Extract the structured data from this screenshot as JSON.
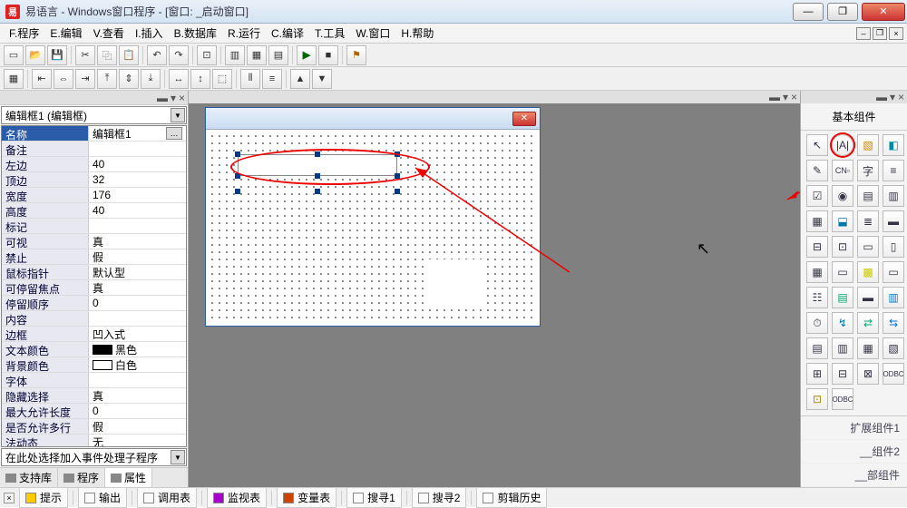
{
  "title": "易语言 - Windows窗口程序 - [窗口: _启动窗口]",
  "menu": [
    "F.程序",
    "E.编辑",
    "V.查看",
    "I.插入",
    "B.数据库",
    "R.运行",
    "C.编译",
    "T.工具",
    "W.窗口",
    "H.帮助"
  ],
  "left": {
    "combo_top": "编辑框1 (编辑框)",
    "combo_event": "在此处选择加入事件处理子程序",
    "tabs": [
      "支持库",
      "程序",
      "属性"
    ],
    "rows": [
      {
        "n": "名称",
        "v": "编辑框1",
        "sel": true,
        "btn": true
      },
      {
        "n": "备注",
        "v": ""
      },
      {
        "n": "左边",
        "v": "40"
      },
      {
        "n": "顶边",
        "v": "32"
      },
      {
        "n": "宽度",
        "v": "176"
      },
      {
        "n": "高度",
        "v": "40"
      },
      {
        "n": "标记",
        "v": ""
      },
      {
        "n": "可视",
        "v": "真"
      },
      {
        "n": "禁止",
        "v": "假"
      },
      {
        "n": "鼠标指针",
        "v": "默认型"
      },
      {
        "n": "可停留焦点",
        "v": "真"
      },
      {
        "n": "停留顺序",
        "v": "0"
      },
      {
        "n": "内容",
        "v": ""
      },
      {
        "n": "边框",
        "v": "凹入式"
      },
      {
        "n": "文本颜色",
        "v": "黑色",
        "sw": "#000000"
      },
      {
        "n": "背景颜色",
        "v": "白色",
        "sw": "#ffffff"
      },
      {
        "n": "字体",
        "v": ""
      },
      {
        "n": "隐藏选择",
        "v": "真"
      },
      {
        "n": "最大允许长度",
        "v": "0"
      },
      {
        "n": "是否允许多行",
        "v": "假"
      },
      {
        "n": "法动态",
        "v": "无"
      }
    ]
  },
  "right": {
    "title": "基本组件",
    "groups": [
      "扩展组件1",
      "__组件2",
      "__部组件"
    ]
  },
  "status": [
    "提示",
    "输出",
    "调用表",
    "监视表",
    "变量表",
    "搜寻1",
    "搜寻2",
    "剪辑历史"
  ],
  "colors": {
    "accent": "#2a5caa"
  }
}
